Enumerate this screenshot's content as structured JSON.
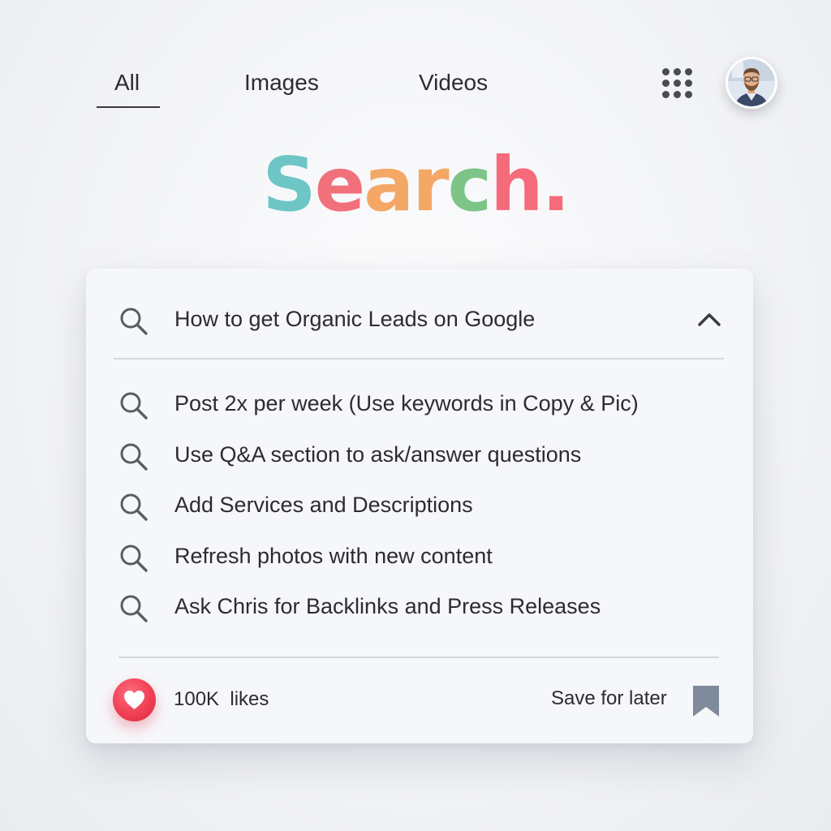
{
  "tabs": {
    "all": "All",
    "images": "Images",
    "videos": "Videos",
    "active": "All"
  },
  "header": {
    "apps_icon": "grid-dots-icon",
    "avatar": "user-avatar"
  },
  "logo": {
    "letters": [
      {
        "char": "S",
        "color": "#6dc6c5"
      },
      {
        "char": "e",
        "color": "#f0707c"
      },
      {
        "char": "a",
        "color": "#f5a766"
      },
      {
        "char": "r",
        "color": "#f5a766"
      },
      {
        "char": "c",
        "color": "#7cc587"
      },
      {
        "char": "h",
        "color": "#f56b7a"
      },
      {
        "char": ".",
        "color": "#f56b7a"
      }
    ]
  },
  "search": {
    "query": "How to get Organic Leads on Google",
    "expand_icon": "chevron-up-icon",
    "suggestions": [
      "Post 2x per week (Use keywords in Copy & Pic)",
      "Use Q&A section to ask/answer questions",
      "Add Services and Descriptions",
      "Refresh photos with new content",
      "Ask Chris for Backlinks and Press Releases"
    ]
  },
  "footer": {
    "likes": "100K  likes",
    "save_label": "Save for later",
    "like_icon": "heart-icon",
    "save_icon": "bookmark-icon"
  },
  "colors": {
    "like_red": "#ee3c50",
    "bookmark_gray": "#7f8a9b",
    "text": "#2c2c30",
    "card_bg": "#f6f7fa"
  }
}
